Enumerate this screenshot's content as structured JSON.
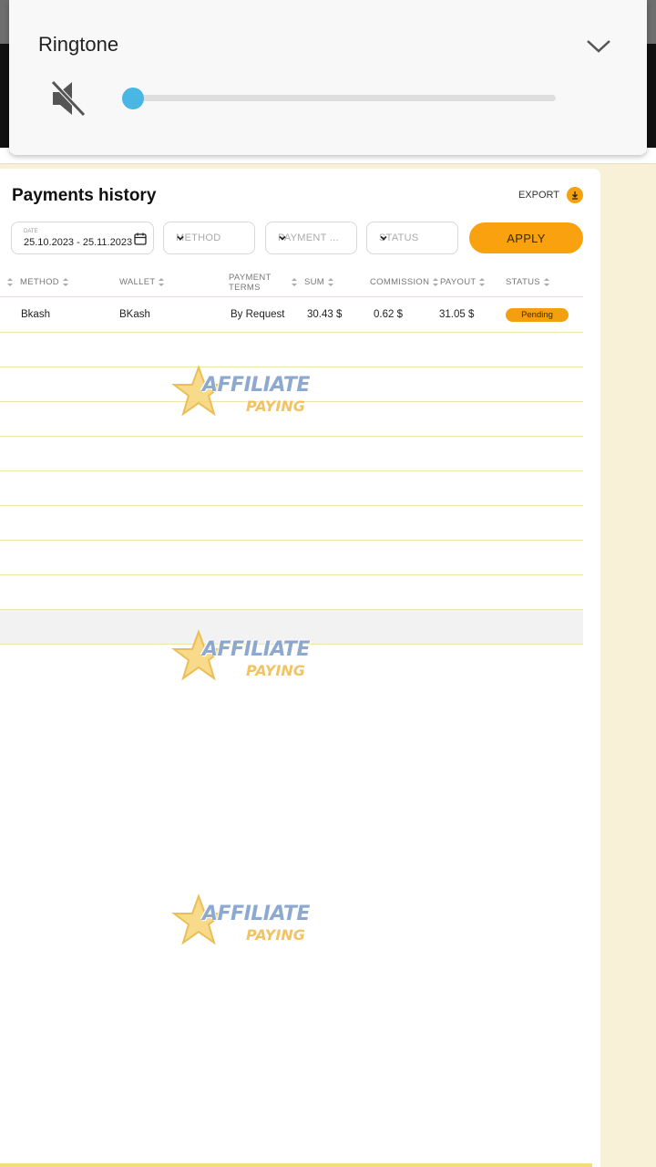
{
  "volume_panel": {
    "title": "Ringtone",
    "level": 0,
    "icons": {
      "mute": "volume-mute-icon",
      "collapse": "chevron-down-icon"
    }
  },
  "page": {
    "title": "Payments history",
    "export_label": "EXPORT"
  },
  "filters": {
    "date_label": "DATE",
    "date_value": "25.10.2023 - 25.11.2023",
    "method_placeholder": "METHOD",
    "payment_placeholder": "PAYMENT ...",
    "status_placeholder": "STATUS",
    "apply_label": "APPLY"
  },
  "table": {
    "columns": {
      "method": "METHOD",
      "wallet": "WALLET",
      "payment_terms_1": "PAYMENT",
      "payment_terms_2": "TERMS",
      "sum": "SUM",
      "commission": "COMMISSION",
      "payout": "PAYOUT",
      "status": "STATUS"
    },
    "rows": [
      {
        "method": "Bkash",
        "wallet": "BKash",
        "payment_terms": "By Request",
        "sum": "30.43 $",
        "commission": "0.62 $",
        "payout": "31.05 $",
        "status": "Pending"
      }
    ]
  },
  "watermark": {
    "line1": "AFFILIATE",
    "line2": "PAYING"
  },
  "colors": {
    "accent": "#f9a10e",
    "slider": "#49b6e3",
    "background": "#f8f1d7",
    "row_border": "#f0e3a8"
  }
}
